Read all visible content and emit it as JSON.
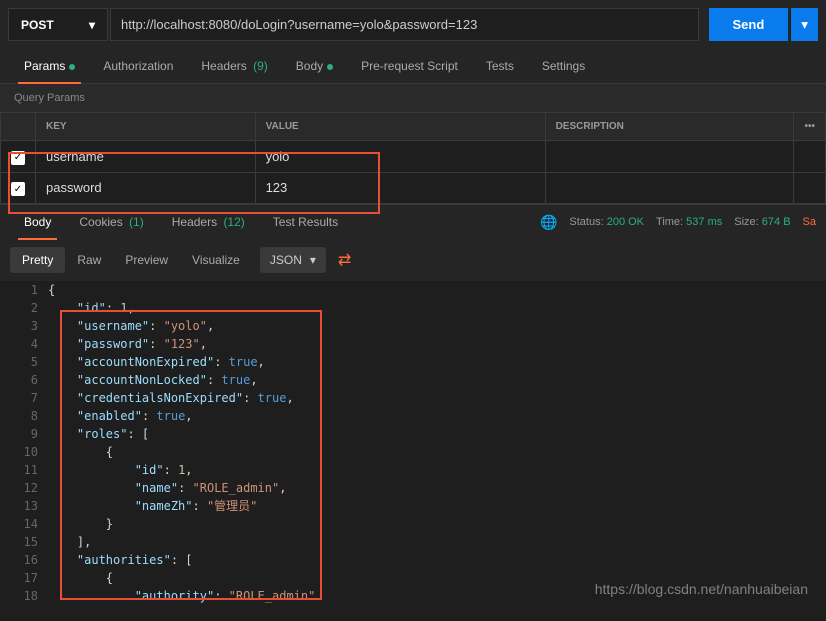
{
  "request": {
    "method": "POST",
    "url": "http://localhost:8080/doLogin?username=yolo&password=123",
    "sendLabel": "Send"
  },
  "tabs": {
    "params": "Params",
    "auth": "Authorization",
    "headers": "Headers",
    "headersCount": "(9)",
    "body": "Body",
    "prescript": "Pre-request Script",
    "tests": "Tests",
    "settings": "Settings"
  },
  "querySection": "Query Params",
  "tableHeaders": {
    "key": "KEY",
    "value": "VALUE",
    "description": "DESCRIPTION"
  },
  "params": [
    {
      "key": "username",
      "value": "yolo"
    },
    {
      "key": "password",
      "value": "123"
    }
  ],
  "respTabs": {
    "body": "Body",
    "cookies": "Cookies",
    "cookiesCount": "(1)",
    "headers": "Headers",
    "headersCount": "(12)",
    "tests": "Test Results"
  },
  "status": {
    "label": "Status:",
    "code": "200 OK",
    "timeLabel": "Time:",
    "time": "537 ms",
    "sizeLabel": "Size:",
    "size": "674 B",
    "save": "Sa"
  },
  "view": {
    "pretty": "Pretty",
    "raw": "Raw",
    "preview": "Preview",
    "visualize": "Visualize",
    "format": "JSON"
  },
  "code": [
    {
      "n": 1,
      "c": [
        {
          "t": "p",
          "v": "{"
        }
      ]
    },
    {
      "n": 2,
      "c": [
        {
          "t": "p",
          "v": "    "
        },
        {
          "t": "k",
          "v": "\"id\""
        },
        {
          "t": "p",
          "v": ": "
        },
        {
          "t": "n",
          "v": "1"
        },
        {
          "t": "p",
          "v": ","
        }
      ]
    },
    {
      "n": 3,
      "c": [
        {
          "t": "p",
          "v": "    "
        },
        {
          "t": "k",
          "v": "\"username\""
        },
        {
          "t": "p",
          "v": ": "
        },
        {
          "t": "s",
          "v": "\"yolo\""
        },
        {
          "t": "p",
          "v": ","
        }
      ]
    },
    {
      "n": 4,
      "c": [
        {
          "t": "p",
          "v": "    "
        },
        {
          "t": "k",
          "v": "\"password\""
        },
        {
          "t": "p",
          "v": ": "
        },
        {
          "t": "s",
          "v": "\"123\""
        },
        {
          "t": "p",
          "v": ","
        }
      ]
    },
    {
      "n": 5,
      "c": [
        {
          "t": "p",
          "v": "    "
        },
        {
          "t": "k",
          "v": "\"accountNonExpired\""
        },
        {
          "t": "p",
          "v": ": "
        },
        {
          "t": "b",
          "v": "true"
        },
        {
          "t": "p",
          "v": ","
        }
      ]
    },
    {
      "n": 6,
      "c": [
        {
          "t": "p",
          "v": "    "
        },
        {
          "t": "k",
          "v": "\"accountNonLocked\""
        },
        {
          "t": "p",
          "v": ": "
        },
        {
          "t": "b",
          "v": "true"
        },
        {
          "t": "p",
          "v": ","
        }
      ]
    },
    {
      "n": 7,
      "c": [
        {
          "t": "p",
          "v": "    "
        },
        {
          "t": "k",
          "v": "\"credentialsNonExpired\""
        },
        {
          "t": "p",
          "v": ": "
        },
        {
          "t": "b",
          "v": "true"
        },
        {
          "t": "p",
          "v": ","
        }
      ]
    },
    {
      "n": 8,
      "c": [
        {
          "t": "p",
          "v": "    "
        },
        {
          "t": "k",
          "v": "\"enabled\""
        },
        {
          "t": "p",
          "v": ": "
        },
        {
          "t": "b",
          "v": "true"
        },
        {
          "t": "p",
          "v": ","
        }
      ]
    },
    {
      "n": 9,
      "c": [
        {
          "t": "p",
          "v": "    "
        },
        {
          "t": "k",
          "v": "\"roles\""
        },
        {
          "t": "p",
          "v": ": ["
        }
      ]
    },
    {
      "n": 10,
      "c": [
        {
          "t": "p",
          "v": "        {"
        }
      ]
    },
    {
      "n": 11,
      "c": [
        {
          "t": "p",
          "v": "            "
        },
        {
          "t": "k",
          "v": "\"id\""
        },
        {
          "t": "p",
          "v": ": "
        },
        {
          "t": "n",
          "v": "1"
        },
        {
          "t": "p",
          "v": ","
        }
      ]
    },
    {
      "n": 12,
      "c": [
        {
          "t": "p",
          "v": "            "
        },
        {
          "t": "k",
          "v": "\"name\""
        },
        {
          "t": "p",
          "v": ": "
        },
        {
          "t": "s",
          "v": "\"ROLE_admin\""
        },
        {
          "t": "p",
          "v": ","
        }
      ]
    },
    {
      "n": 13,
      "c": [
        {
          "t": "p",
          "v": "            "
        },
        {
          "t": "k",
          "v": "\"nameZh\""
        },
        {
          "t": "p",
          "v": ": "
        },
        {
          "t": "s",
          "v": "\"管理员\""
        }
      ]
    },
    {
      "n": 14,
      "c": [
        {
          "t": "p",
          "v": "        }"
        }
      ]
    },
    {
      "n": 15,
      "c": [
        {
          "t": "p",
          "v": "    ],"
        }
      ]
    },
    {
      "n": 16,
      "c": [
        {
          "t": "p",
          "v": "    "
        },
        {
          "t": "k",
          "v": "\"authorities\""
        },
        {
          "t": "p",
          "v": ": ["
        }
      ]
    },
    {
      "n": 17,
      "c": [
        {
          "t": "p",
          "v": "        {"
        }
      ]
    },
    {
      "n": 18,
      "c": [
        {
          "t": "p",
          "v": "            "
        },
        {
          "t": "k",
          "v": "\"authority\""
        },
        {
          "t": "p",
          "v": ": "
        },
        {
          "t": "s",
          "v": "\"ROLE_admin\""
        }
      ]
    }
  ],
  "watermark": "https://blog.csdn.net/nanhuaibeian"
}
